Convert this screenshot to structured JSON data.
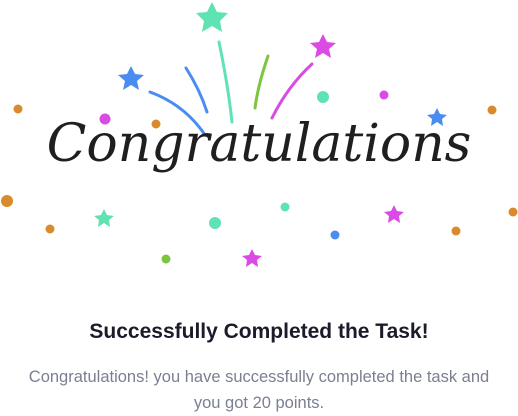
{
  "celebration": {
    "script_text": "Congratulations",
    "colors": {
      "teal": "#5fe3b3",
      "magenta": "#d94be4",
      "blue": "#4a8df0",
      "orange": "#d98a2c",
      "green": "#7cc63f",
      "ink": "#1f1f1f"
    }
  },
  "dialog": {
    "heading": "Successfully Completed the Task!",
    "message": "Congratulations! you have successfully completed the task and you got 20 points."
  }
}
